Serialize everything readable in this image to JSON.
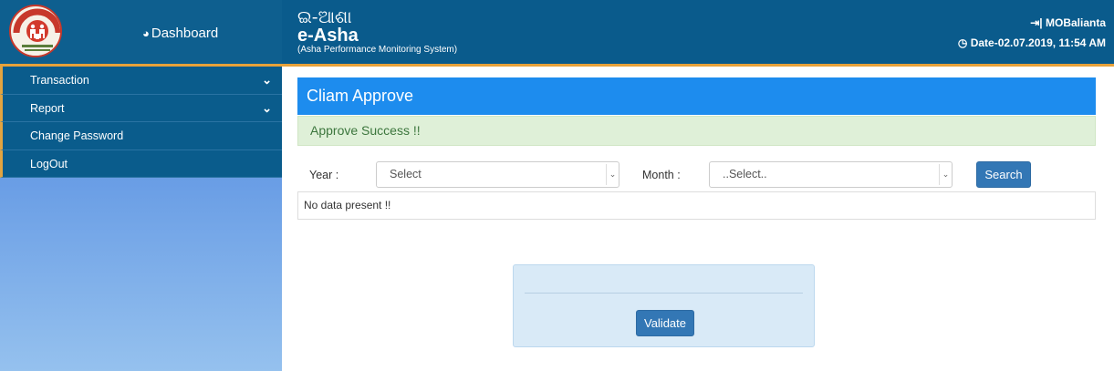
{
  "header": {
    "logo_text": "NATIONAL RURAL HEALTH MISSION",
    "dashboard_label": "Dashboard",
    "title_odia": "ଇ-ଆଶା",
    "title": "e-Asha",
    "subtitle": "(Asha Performance Monitoring System)",
    "user": "MOBalianta",
    "datetime": "Date-02.07.2019, 11:54 AM"
  },
  "sidebar": {
    "items": [
      {
        "label": "Transaction",
        "has_submenu": true
      },
      {
        "label": "Report",
        "has_submenu": true
      },
      {
        "label": "Change Password",
        "has_submenu": false
      },
      {
        "label": "LogOut",
        "has_submenu": false
      }
    ]
  },
  "main": {
    "panel_title": "Cliam Approve",
    "alert": "Approve Success !!",
    "year_label": "Year :",
    "year_value": "Select",
    "month_label": "Month :",
    "month_value": "..Select..",
    "search_label": "Search",
    "no_data": "No data present !!",
    "validate_label": "Validate"
  },
  "colors": {
    "header_bg": "#0a5b8c",
    "accent_border": "#e8a23a",
    "panel_head": "#1d8cee",
    "alert_bg": "#dff0d8",
    "alert_text": "#3c763d",
    "button": "#3377b5"
  },
  "icons": {
    "dashboard": "tachometer-icon",
    "user": "sign-out-icon",
    "clock": "clock-icon",
    "submenu": "chevron-down-icon",
    "select_caret": "chevron-down-icon"
  }
}
